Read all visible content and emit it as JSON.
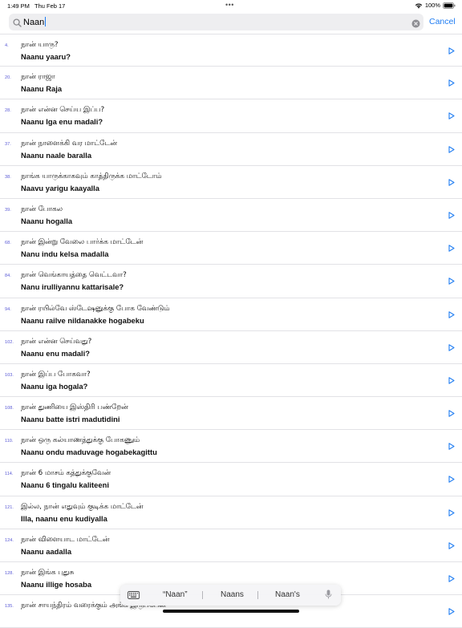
{
  "status_bar": {
    "time": "1:49 PM",
    "date": "Thu Feb 17",
    "battery": "100%"
  },
  "search": {
    "value": "Naan",
    "cancel_label": "Cancel"
  },
  "rows": [
    {
      "num": "4.",
      "tamil": "நான் யாரு?",
      "roman": "Naanu yaaru?"
    },
    {
      "num": "20.",
      "tamil": "நான் ராஜா",
      "roman": "Naanu Raja"
    },
    {
      "num": "28.",
      "tamil": "நான் என்ன செய்ய இப்ப?",
      "roman": "Naanu Iga enu madali?"
    },
    {
      "num": "37.",
      "tamil": "நான் நாளைக்கி வர மாட்டேன்",
      "roman": "Naanu naale baralla"
    },
    {
      "num": "38.",
      "tamil": "நாங்க யாருக்காகவும் காத்திருக்க மாட்டோம்",
      "roman": "Naavu yarigu kaayalla"
    },
    {
      "num": "39.",
      "tamil": "நான் போகல",
      "roman": "Naanu hogalla"
    },
    {
      "num": "68.",
      "tamil": "நான் இன்று வேலை பார்க்க மாட்டேன்",
      "roman": "Nanu indu kelsa madalla"
    },
    {
      "num": "84.",
      "tamil": "நான் வெங்காயத்தை வெட்டவா?",
      "roman": "Nanu irulliyannu kattarisale?"
    },
    {
      "num": "94.",
      "tamil": "நான் ரயில்வே ஸ்டேஷனுக்கு போக வேண்டும்",
      "roman": "Naanu railve nildanakke hogabeku"
    },
    {
      "num": "102.",
      "tamil": "நான் என்ன செய்வது?",
      "roman": "Naanu enu madali?"
    },
    {
      "num": "103.",
      "tamil": "நான் இப்ப போகவா?",
      "roman": "Naanu iga hogala?"
    },
    {
      "num": "108.",
      "tamil": "நான் துணியை இஸ்திரி பண்றேன்",
      "roman": "Naanu batte istri madutidini"
    },
    {
      "num": "110.",
      "tamil": "நான் ஒரு கல்யாணத்துக்கு போகணும்",
      "roman": "Naanu ondu maduvage hogabekagittu"
    },
    {
      "num": "114.",
      "tamil": "நான் 6 மாசம் கத்துக்குவேன்",
      "roman": "Naanu 6 tingalu kaliteeni"
    },
    {
      "num": "121.",
      "tamil": "இல்ல, நான் எதுவும் குடிக்க மாட்டேன்",
      "roman": "Illa, naanu enu kudiyalla"
    },
    {
      "num": "124.",
      "tamil": "நான் விளையாட மாட்டேன்",
      "roman": "Naanu aadalla"
    },
    {
      "num": "128.",
      "tamil": "நான் இங்க புதுசு",
      "roman": "Naanu illige hosaba"
    },
    {
      "num": "135.",
      "tamil": "நான் சாயந்திரம் வரைக்கும் அங்க இருப்பேன்",
      "roman": ""
    }
  ],
  "keyboard_suggestions": {
    "items": [
      "“Naan”",
      "Naans",
      "Naan's"
    ]
  },
  "colors": {
    "accent": "#1e7cf2",
    "number": "#5b5bd6",
    "separator": "#e2e2e6"
  },
  "icons": {
    "search": "search-icon",
    "clear": "clear-icon",
    "play": "play-icon",
    "keyboard": "keyboard-icon",
    "mic": "mic-icon",
    "wifi": "wifi-icon",
    "battery": "battery-icon"
  }
}
